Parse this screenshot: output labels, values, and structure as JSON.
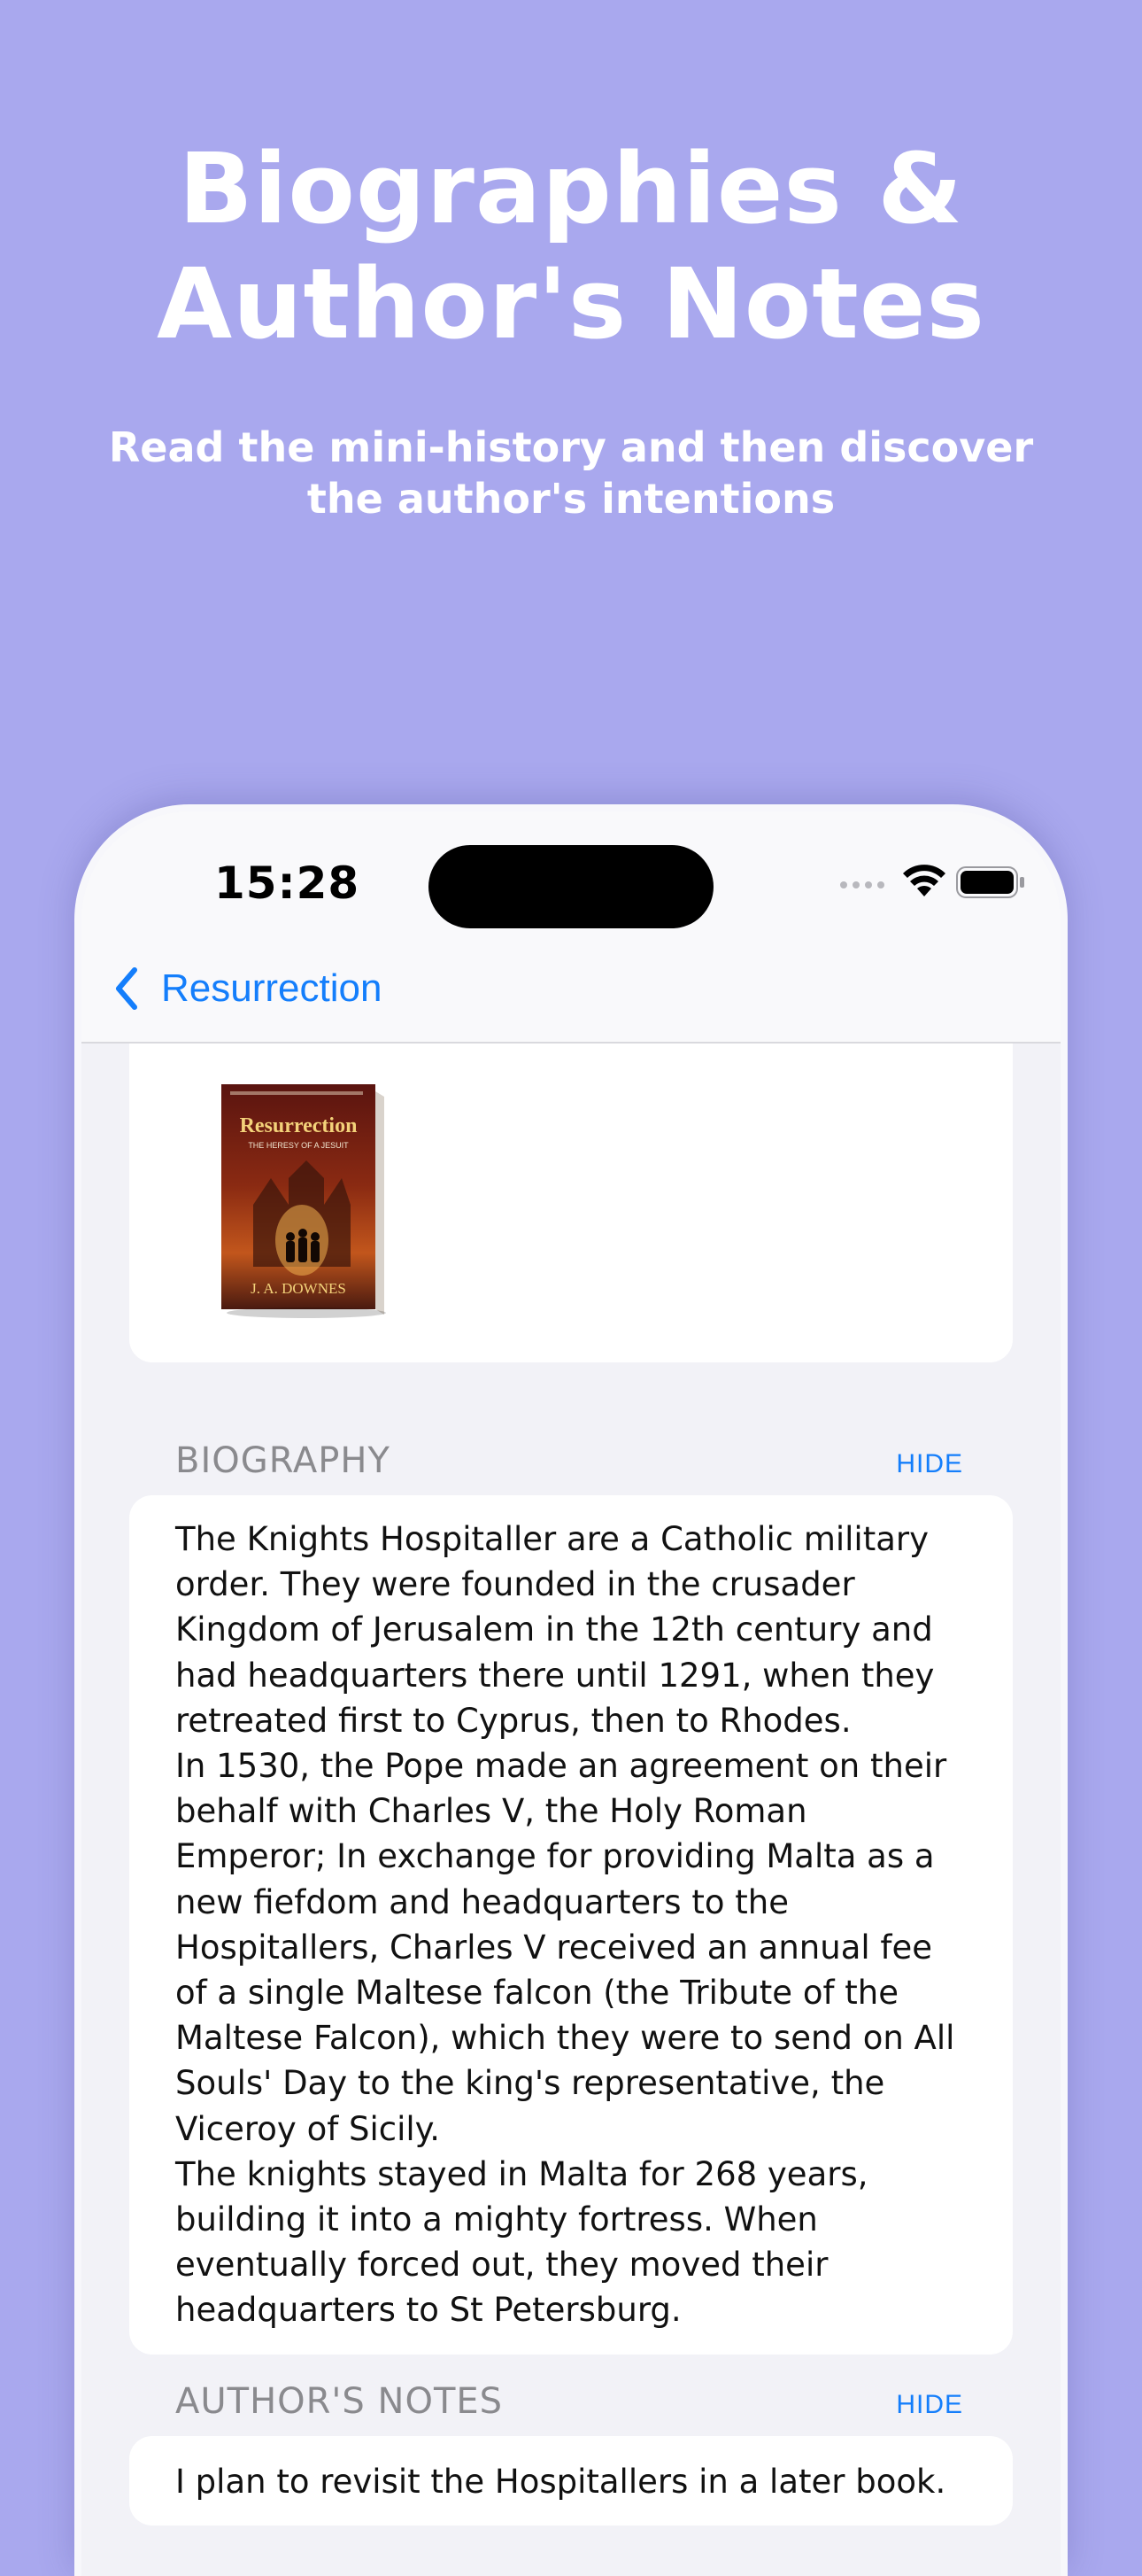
{
  "hero": {
    "title_line1": "Biographies &",
    "title_line2": "Author's Notes",
    "subtitle_line1": "Read the mini-history and then discover",
    "subtitle_line2": "the author's intentions"
  },
  "status_bar": {
    "time": "15:28",
    "icons": [
      "signal-dots-icon",
      "wifi-icon",
      "battery-icon"
    ]
  },
  "nav": {
    "back_label": "Resurrection",
    "back_icon": "chevron-left-icon"
  },
  "book_cover": {
    "title": "Resurrection",
    "subtitle": "THE HERESY OF A JESUIT",
    "author": "J. A. DOWNES"
  },
  "biography": {
    "heading": "BIOGRAPHY",
    "hide_label": "HIDE",
    "paragraphs": [
      "The Knights Hospitaller are a Catholic military order. They were founded in the crusader Kingdom of Jerusalem in the 12th century and had headquarters there until 1291, when they retreated first to Cyprus, then to Rhodes.",
      "In 1530, the Pope made an agreement on their behalf with Charles V, the Holy Roman Emperor; In exchange for providing Malta as a new fiefdom and headquarters to the Hospitallers, Charles V received an annual fee of a single Maltese falcon (the Tribute of the Maltese Falcon), which they were to send on All Souls' Day to the king's representative, the Viceroy of Sicily.",
      "The knights stayed in Malta for 268 years, building it into a mighty fortress. When eventually forced out, they moved their headquarters to St Petersburg."
    ]
  },
  "authors_notes": {
    "heading": "AUTHOR'S NOTES",
    "hide_label": "HIDE",
    "text": "I plan to revisit the Hospitallers in a later book."
  },
  "colors": {
    "background": "#a9a8ee",
    "accent": "#147efb"
  }
}
